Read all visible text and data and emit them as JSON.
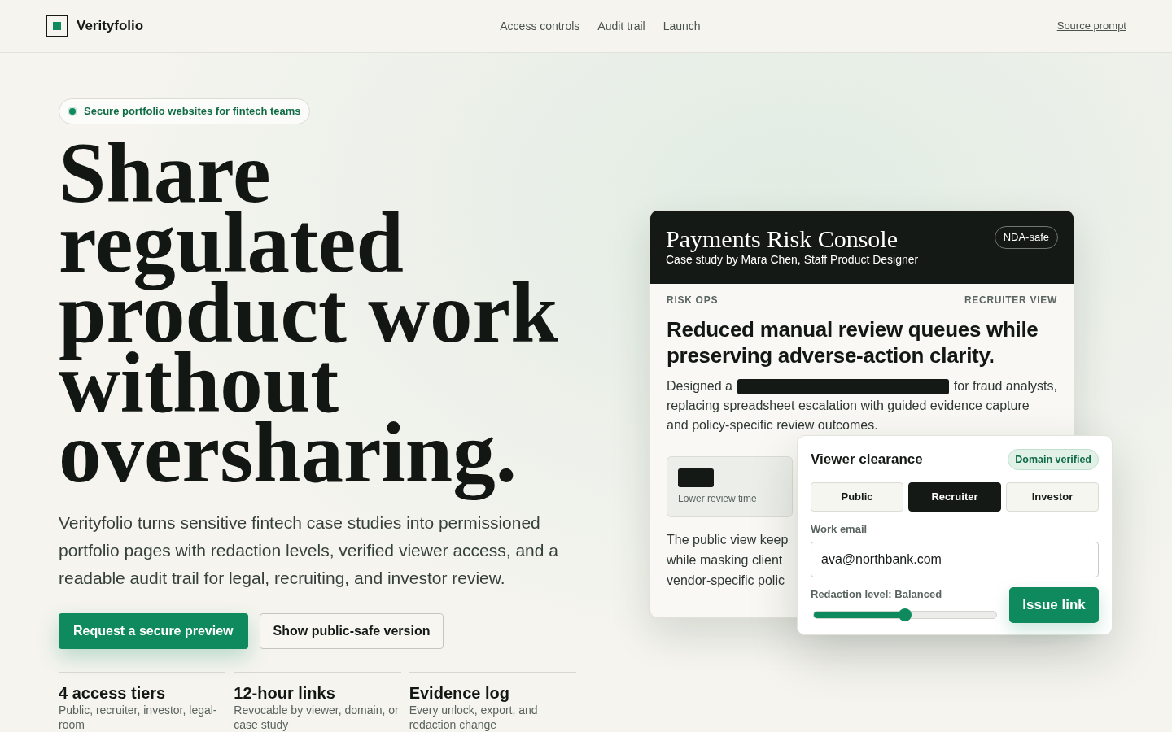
{
  "header": {
    "brand": "Verityfolio",
    "nav": [
      {
        "label": "Access controls"
      },
      {
        "label": "Audit trail"
      },
      {
        "label": "Launch"
      }
    ],
    "source_link": "Source prompt"
  },
  "hero": {
    "badge": "Secure portfolio websites for fintech teams",
    "title": "Share regulated product work without oversharing.",
    "lead": "Verityfolio turns sensitive fintech case studies into permissioned portfolio pages with redaction levels, verified viewer access, and a readable audit trail for legal, recruiting, and investor review.",
    "actions": [
      {
        "label": "Request a secure preview",
        "kind": "primary"
      },
      {
        "label": "Show public-safe version",
        "kind": "secondary"
      }
    ],
    "stats": [
      {
        "title": "4 access tiers",
        "text": "Public, recruiter, investor, legal-room"
      },
      {
        "title": "12-hour links",
        "text": "Revocable by viewer, domain, or case study"
      },
      {
        "title": "Evidence log",
        "text": "Every unlock, export, and redaction change"
      }
    ]
  },
  "case_card": {
    "title": "Payments Risk Console",
    "byline": "Case study by Mara Chen, Staff Product Designer",
    "badge": "NDA-safe",
    "eyebrow": "RISK OPS",
    "view": "RECRUITER VIEW",
    "headline": "Reduced manual review queues while preserving adverse-action clarity.",
    "intro": {
      "before": "Designed a",
      "after": "for fraud analysts,",
      "lines": [
        "replacing spreadsheet escalation with guided evidence capture",
        "and policy-specific review outcomes."
      ]
    },
    "metric": {
      "label": "Lower review time"
    },
    "covered_lines": [
      "The public view keep",
      "while masking client",
      "vendor-specific polic"
    ]
  },
  "clearance": {
    "title": "Viewer clearance",
    "status": "Domain verified",
    "tiers": [
      {
        "label": "Public",
        "selected": false
      },
      {
        "label": "Recruiter",
        "selected": true
      },
      {
        "label": "Investor",
        "selected": false
      }
    ],
    "email_label": "Work email",
    "email_value": "ava@northbank.com",
    "redaction": {
      "label": "Redaction level: Balanced",
      "level": 0.5
    },
    "submit": "Issue link"
  }
}
